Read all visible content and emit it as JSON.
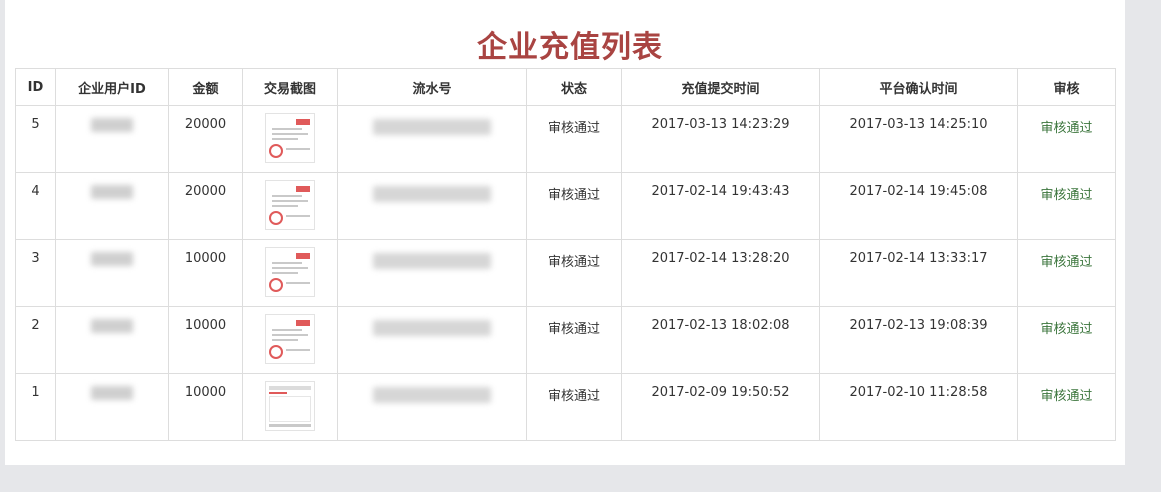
{
  "page": {
    "title": "企业充值列表"
  },
  "table": {
    "headers": [
      "ID",
      "企业用户ID",
      "金额",
      "交易截图",
      "流水号",
      "状态",
      "充值提交时间",
      "平台确认时间",
      "审核"
    ],
    "rows": [
      {
        "id": "5",
        "amount": "20000",
        "status": "审核通过",
        "submit_time": "2017-03-13 14:23:29",
        "confirm_time": "2017-03-13 14:25:10",
        "audit": "审核通过"
      },
      {
        "id": "4",
        "amount": "20000",
        "status": "审核通过",
        "submit_time": "2017-02-14 19:43:43",
        "confirm_time": "2017-02-14 19:45:08",
        "audit": "审核通过"
      },
      {
        "id": "3",
        "amount": "10000",
        "status": "审核通过",
        "submit_time": "2017-02-14 13:28:20",
        "confirm_time": "2017-02-14 13:33:17",
        "audit": "审核通过"
      },
      {
        "id": "2",
        "amount": "10000",
        "status": "审核通过",
        "submit_time": "2017-02-13 18:02:08",
        "confirm_time": "2017-02-13 19:08:39",
        "audit": "审核通过"
      },
      {
        "id": "1",
        "amount": "10000",
        "status": "审核通过",
        "submit_time": "2017-02-09 19:50:52",
        "confirm_time": "2017-02-10 11:28:58",
        "audit": "审核通过"
      }
    ]
  },
  "colors": {
    "title": "#a94442",
    "audit_link": "#3c763d",
    "border": "#dddddd",
    "background": "#e6e7ea"
  }
}
